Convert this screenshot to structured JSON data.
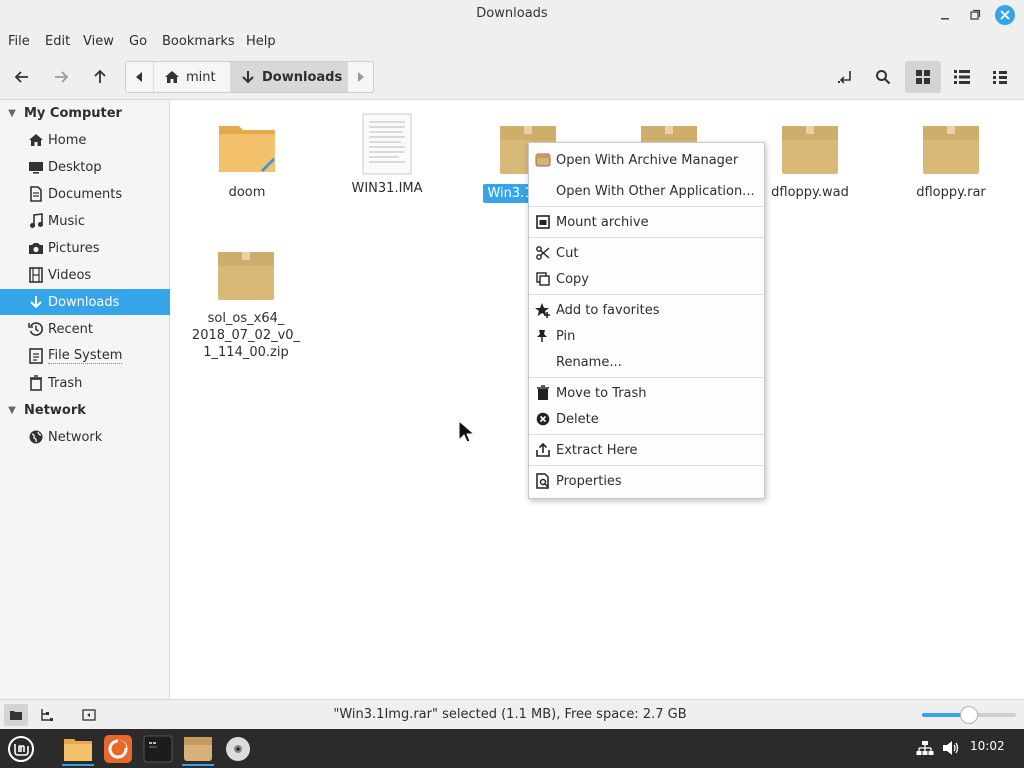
{
  "window": {
    "title": "Downloads"
  },
  "menubar": {
    "items": [
      "File",
      "Edit",
      "View",
      "Go",
      "Bookmarks",
      "Help"
    ]
  },
  "breadcrumb": {
    "items": [
      "mint",
      "Downloads"
    ]
  },
  "sidebar": {
    "sections": [
      {
        "label": "My Computer",
        "items": [
          "Home",
          "Desktop",
          "Documents",
          "Music",
          "Pictures",
          "Videos",
          "Downloads",
          "Recent",
          "File System",
          "Trash"
        ]
      },
      {
        "label": "Network",
        "items": [
          "Network"
        ]
      }
    ],
    "active": "Downloads"
  },
  "files": [
    {
      "name": "doom",
      "type": "folder"
    },
    {
      "name": "WIN31.IMA",
      "type": "document"
    },
    {
      "name": "Win3.1",
      "type": "archive",
      "selected": true
    },
    {
      "name": "",
      "type": "archive"
    },
    {
      "name": "dfloppy.wad",
      "type": "archive"
    },
    {
      "name": "dfloppy.rar",
      "type": "archive"
    },
    {
      "name_lines": [
        "sol_os_x64_",
        "2018_07_02_v0_",
        "1_114_00.zip"
      ],
      "type": "archive"
    }
  ],
  "context_menu": {
    "items": [
      {
        "label": "Open With Archive Manager",
        "icon": "archive-manager-icon"
      },
      {
        "label": "Open With Other Application...",
        "icon": ""
      },
      {
        "label": "Mount archive",
        "icon": "mount-icon"
      },
      {
        "label": "Cut",
        "icon": "scissors-icon"
      },
      {
        "label": "Copy",
        "icon": "copy-icon"
      },
      {
        "label": "Add to favorites",
        "icon": "star-add-icon"
      },
      {
        "label": "Pin",
        "icon": "pin-icon"
      },
      {
        "label": "Rename...",
        "icon": ""
      },
      {
        "label": "Move to Trash",
        "icon": "trash-icon"
      },
      {
        "label": "Delete",
        "icon": "delete-icon"
      },
      {
        "label": "Extract Here",
        "icon": "extract-icon"
      },
      {
        "label": "Properties",
        "icon": "properties-icon"
      }
    ]
  },
  "statusbar": {
    "text": "\"Win3.1Img.rar\" selected (1.1 MB), Free space: 2.7 GB",
    "zoom_level": 0.5
  },
  "taskbar": {
    "clock": "10:02"
  },
  "colors": {
    "accent": "#35a4e8",
    "folder": "#f3c06b",
    "archive": "#d8b978",
    "taskbar": "#2b2b2b"
  }
}
